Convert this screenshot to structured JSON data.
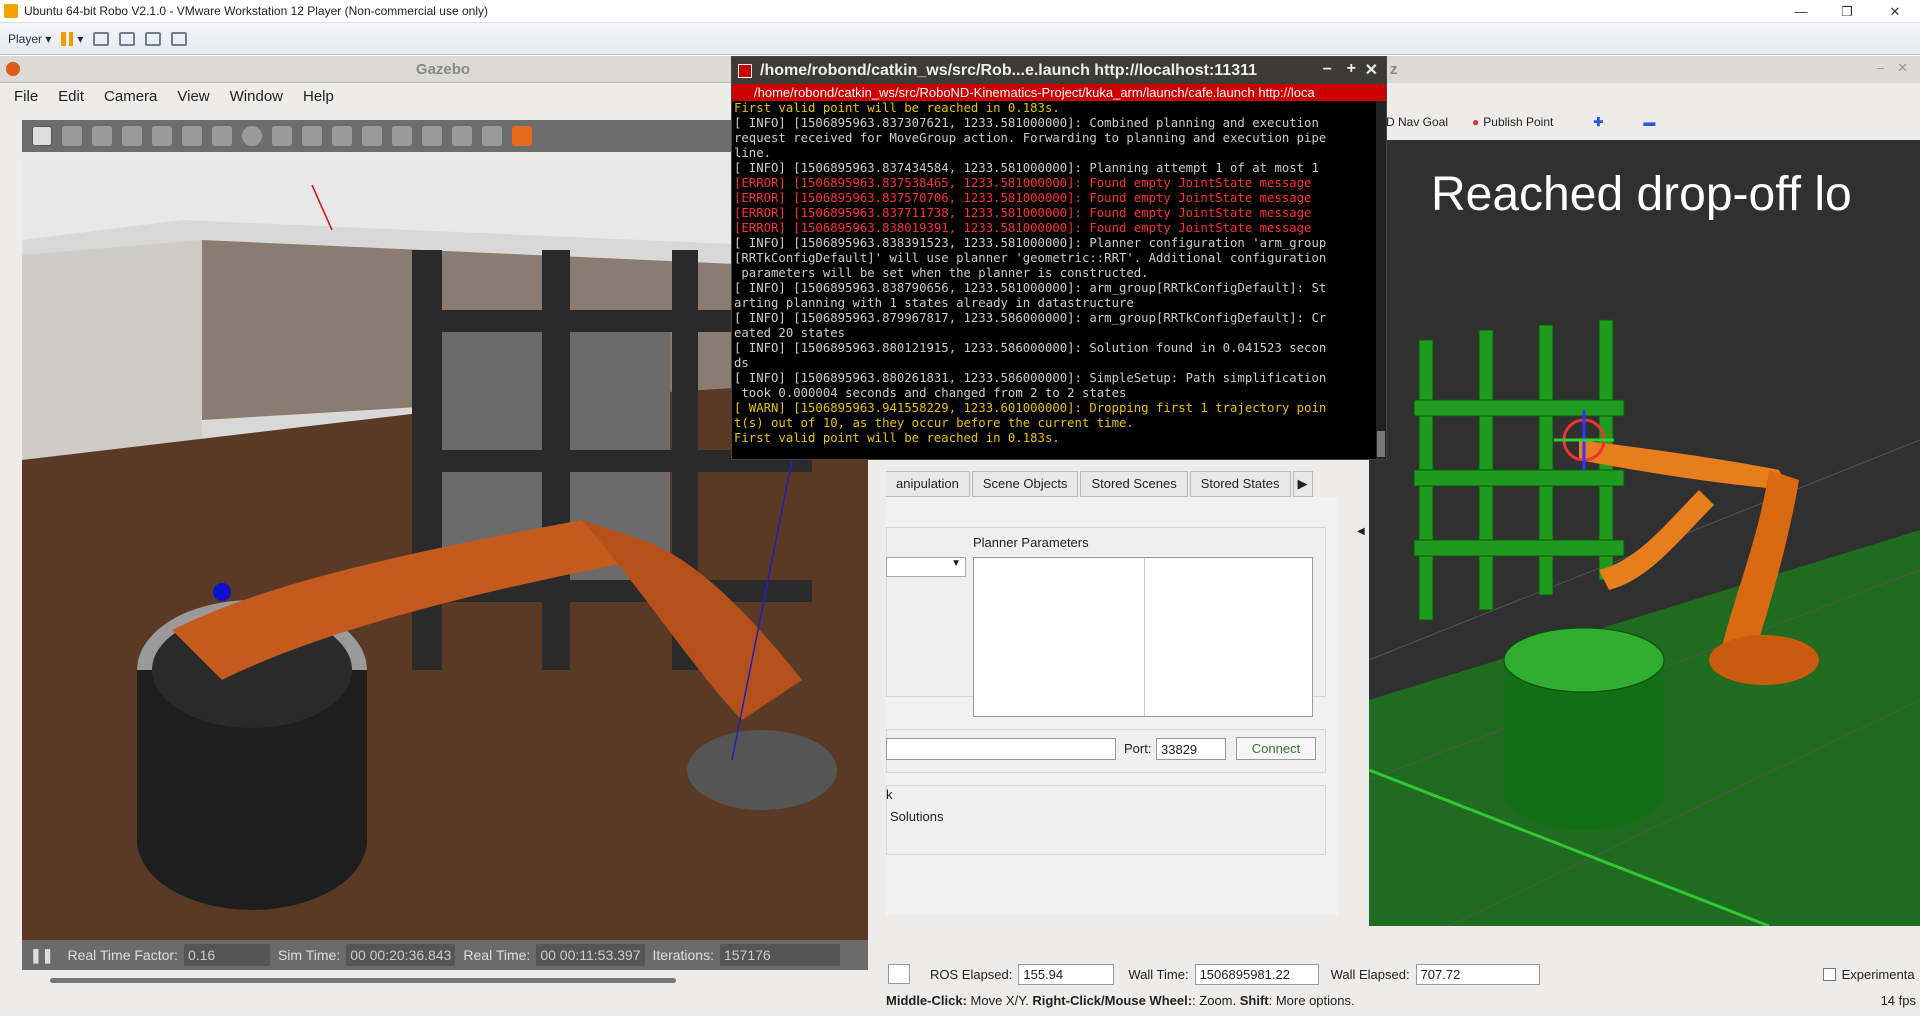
{
  "vmware": {
    "title": "Ubuntu 64-bit Robo V2.1.0 - VMware Workstation 12 Player (Non-commercial use only)",
    "player_label": "Player"
  },
  "gazebo": {
    "title": "Gazebo",
    "menu": [
      "File",
      "Edit",
      "Camera",
      "View",
      "Window",
      "Help"
    ],
    "status": {
      "rtf_label": "Real Time Factor:",
      "rtf": "0.16",
      "sim_label": "Sim Time:",
      "sim": "00 00:20:36.843",
      "real_label": "Real Time:",
      "real": "00 00:11:53.397",
      "iter_label": "Iterations:",
      "iter": "157176"
    }
  },
  "terminal": {
    "title": "/home/robond/catkin_ws/src/Rob...e.launch http://localhost:11311",
    "tab": "/home/robond/catkin_ws/src/RoboND-Kinematics-Project/kuka_arm/launch/cafe.launch http://loca",
    "lines": [
      {
        "c": "yl",
        "t": "First valid point will be reached in 0.183s."
      },
      {
        "c": "wh",
        "t": "[ INFO] [1506895963.837307621, 1233.581000000]: Combined planning and execution"
      },
      {
        "c": "wh",
        "t": "request received for MoveGroup action. Forwarding to planning and execution pipe"
      },
      {
        "c": "wh",
        "t": "line."
      },
      {
        "c": "wh",
        "t": "[ INFO] [1506895963.837434584, 1233.581000000]: Planning attempt 1 of at most 1"
      },
      {
        "c": "rd",
        "t": "[ERROR] [1506895963.837538465, 1233.581000000]: Found empty JointState message"
      },
      {
        "c": "rd",
        "t": "[ERROR] [1506895963.837570706, 1233.581000000]: Found empty JointState message"
      },
      {
        "c": "rd",
        "t": "[ERROR] [1506895963.837711738, 1233.581000000]: Found empty JointState message"
      },
      {
        "c": "rd",
        "t": "[ERROR] [1506895963.838019391, 1233.581000000]: Found empty JointState message"
      },
      {
        "c": "wh",
        "t": "[ INFO] [1506895963.838391523, 1233.581000000]: Planner configuration 'arm_group"
      },
      {
        "c": "wh",
        "t": "[RRTkConfigDefault]' will use planner 'geometric::RRT'. Additional configuration"
      },
      {
        "c": "wh",
        "t": " parameters will be set when the planner is constructed."
      },
      {
        "c": "wh",
        "t": "[ INFO] [1506895963.838790656, 1233.581000000]: arm_group[RRTkConfigDefault]: St"
      },
      {
        "c": "wh",
        "t": "arting planning with 1 states already in datastructure"
      },
      {
        "c": "wh",
        "t": "[ INFO] [1506895963.879967817, 1233.586000000]: arm_group[RRTkConfigDefault]: Cr"
      },
      {
        "c": "wh",
        "t": "eated 20 states"
      },
      {
        "c": "wh",
        "t": "[ INFO] [1506895963.880121915, 1233.586000000]: Solution found in 0.041523 secon"
      },
      {
        "c": "wh",
        "t": "ds"
      },
      {
        "c": "wh",
        "t": "[ INFO] [1506895963.880261831, 1233.586000000]: SimpleSetup: Path simplification"
      },
      {
        "c": "wh",
        "t": " took 0.000004 seconds and changed from 2 to 2 states"
      },
      {
        "c": "yl",
        "t": "[ WARN] [1506895963.941558229, 1233.601000000]: Dropping first 1 trajectory poin"
      },
      {
        "c": "yl",
        "t": "t(s) out of 10, as they occur before the current time."
      },
      {
        "c": "yl",
        "t": "First valid point will be reached in 0.183s."
      }
    ]
  },
  "rviz": {
    "title_fragment": "z",
    "tools": {
      "nav_goal": "D Nav Goal",
      "publish_point": "Publish Point"
    },
    "tabs": [
      "anipulation",
      "Scene Objects",
      "Stored Scenes",
      "Stored States"
    ],
    "planner_params_label": "Planner Parameters",
    "port_label": "Port:",
    "port": "33829",
    "connect": "Connect",
    "x_label": "k",
    "solutions_label": "Solutions",
    "overlay_text": "Reached  drop-off  lo",
    "bottom": {
      "ros_elapsed_label": "ROS Elapsed:",
      "ros_elapsed": "155.94",
      "wall_time_label": "Wall Time:",
      "wall_time": "1506895981.22",
      "wall_elapsed_label": "Wall Elapsed:",
      "wall_elapsed": "707.72",
      "experimental": "Experimenta",
      "help_left": "Middle-Click:",
      "help_1": " Move X/Y. ",
      "help_rc": "Right-Click/Mouse Wheel:",
      "help_2": ": Zoom. ",
      "help_shift": "Shift",
      "help_3": ": More options.",
      "fps": "14 fps"
    }
  }
}
